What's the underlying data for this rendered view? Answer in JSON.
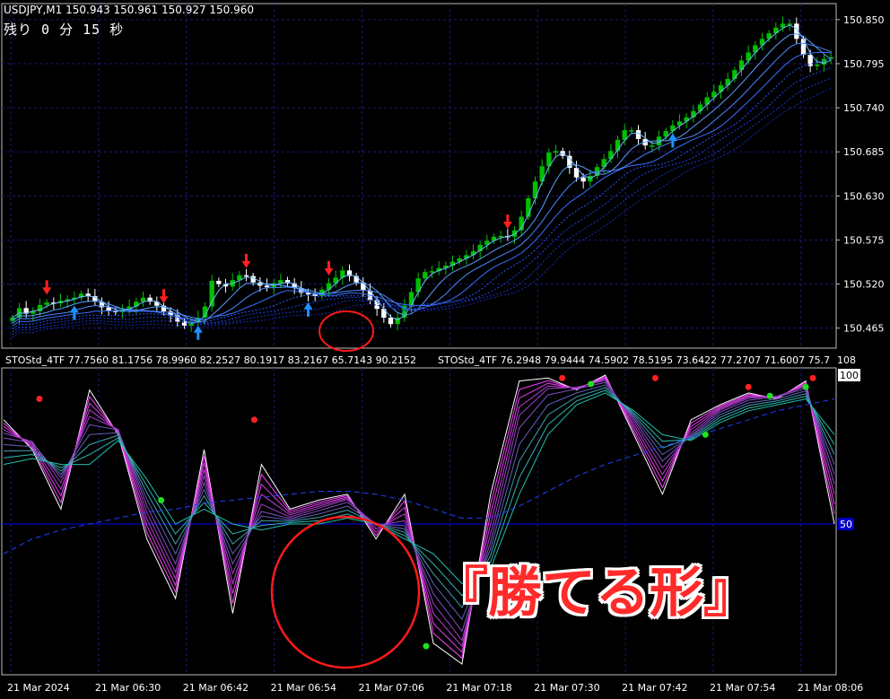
{
  "header": {
    "symbol_line": "USDJPY,M1  150.943 150.961 150.927 150.960",
    "timer": "残り 0 分 15 秒"
  },
  "indicator": {
    "label_1": "STOStd_4TF 77.7560 81.1756 78.9960 82.2527 80.1917 83.2167 65.7143 90.2152",
    "label_2": "STOStd_4TF 76.2948 79.9444 74.5902 78.5195 73.6422 77.2707 71.6007 75.7",
    "right_label": "108"
  },
  "annotation": {
    "text": "『勝てる形』"
  },
  "colors": {
    "background": "#000000",
    "grid": "#1a1a7a",
    "bull_candle": "#00c000",
    "bear_candle": "#ffffff",
    "arrow_up": "#1e90ff",
    "arrow_down": "#ff2020",
    "circle": "#ff1a1a",
    "level_line": "#0000ff"
  },
  "chart_data": [
    {
      "type": "candlestick",
      "title": "USDJPY,M1",
      "y_ticks": [
        "150.850",
        "150.795",
        "150.740",
        "150.685",
        "150.630",
        "150.575",
        "150.520",
        "150.465"
      ],
      "ylim": [
        150.44,
        150.87
      ],
      "x_ticks": [
        "21 Mar 2024",
        "21 Mar 06:30",
        "21 Mar 06:42",
        "21 Mar 06:54",
        "21 Mar 07:06",
        "21 Mar 07:18",
        "21 Mar 07:30",
        "21 Mar 07:42",
        "21 Mar 07:54",
        "21 Mar 08:06"
      ],
      "close": [
        150.478,
        150.49,
        150.483,
        150.486,
        150.494,
        150.497,
        150.496,
        150.499,
        150.501,
        150.503,
        150.508,
        150.505,
        150.498,
        150.491,
        150.487,
        150.485,
        150.488,
        150.492,
        150.498,
        150.503,
        150.498,
        150.493,
        150.486,
        150.481,
        150.473,
        150.468,
        150.472,
        150.478,
        150.492,
        150.524,
        150.52,
        150.517,
        150.525,
        150.531,
        150.53,
        150.522,
        150.518,
        150.516,
        150.521,
        150.525,
        150.521,
        150.515,
        150.509,
        150.507,
        150.505,
        150.513,
        150.521,
        150.528,
        150.537,
        150.53,
        150.522,
        150.512,
        150.5,
        150.489,
        150.478,
        150.47,
        150.478,
        150.493,
        150.51,
        150.527,
        150.535,
        150.536,
        150.54,
        150.543,
        150.548,
        150.552,
        150.556,
        150.561,
        150.569,
        150.574,
        150.579,
        150.58,
        150.579,
        150.587,
        150.604,
        150.627,
        150.648,
        150.667,
        150.684,
        150.686,
        150.68,
        150.665,
        150.653,
        150.648,
        150.655,
        150.666,
        150.676,
        150.686,
        150.7,
        150.712,
        150.712,
        150.701,
        150.693,
        150.693,
        150.704,
        150.711,
        150.718,
        150.723,
        150.728,
        150.736,
        150.744,
        150.753,
        150.76,
        150.768,
        150.776,
        150.787,
        150.799,
        150.809,
        150.818,
        150.826,
        150.833,
        150.84,
        150.845,
        150.845,
        150.826,
        150.806,
        150.792,
        150.794,
        150.801,
        150.803
      ],
      "signals": [
        {
          "type": "sell",
          "index": 5
        },
        {
          "type": "sell",
          "index": 22
        },
        {
          "type": "sell",
          "index": 34
        },
        {
          "type": "sell",
          "index": 46
        },
        {
          "type": "sell",
          "index": 72
        },
        {
          "type": "buy",
          "index": 9
        },
        {
          "type": "buy",
          "index": 27
        },
        {
          "type": "buy",
          "index": 43
        },
        {
          "type": "buy",
          "index": 96
        }
      ]
    },
    {
      "type": "line",
      "title": "STOStd_4TF",
      "y_ticks": [
        "100",
        "50"
      ],
      "ylim": [
        0,
        100
      ],
      "level": 50,
      "x": [
        0,
        4,
        8,
        12,
        16,
        20,
        24,
        28,
        32,
        36,
        40,
        44,
        48,
        52,
        56,
        60,
        64,
        68,
        72,
        76,
        80,
        84,
        88,
        92,
        96,
        100,
        104,
        108,
        112,
        116
      ],
      "series": [
        {
          "values": [
            85,
            75,
            55,
            95,
            80,
            45,
            25,
            75,
            20,
            70,
            55,
            58,
            60,
            45,
            60,
            10,
            3,
            60,
            98,
            99,
            95,
            100,
            80,
            60,
            85,
            90,
            94,
            92,
            98,
            50
          ]
        },
        {
          "values": [
            80,
            78,
            65,
            85,
            82,
            55,
            35,
            65,
            35,
            55,
            52,
            55,
            58,
            50,
            50,
            25,
            12,
            45,
            85,
            95,
            96,
            98,
            85,
            70,
            80,
            88,
            92,
            93,
            96,
            65
          ]
        },
        {
          "values": [
            70,
            72,
            70,
            70,
            78,
            65,
            50,
            55,
            50,
            48,
            50,
            50,
            52,
            50,
            45,
            40,
            30,
            35,
            60,
            80,
            90,
            94,
            88,
            80,
            78,
            84,
            88,
            90,
            92,
            80
          ]
        },
        {
          "values": [
            40,
            45,
            48,
            50,
            52,
            54,
            55,
            57,
            58,
            59,
            60,
            61,
            61,
            60,
            58,
            55,
            52,
            52,
            56,
            61,
            66,
            70,
            73,
            76,
            79,
            82,
            85,
            88,
            90,
            92
          ]
        }
      ],
      "markers": [
        {
          "color": "red",
          "x": 5,
          "y": 92
        },
        {
          "color": "red",
          "x": 35,
          "y": 85
        },
        {
          "color": "green",
          "x": 22,
          "y": 58
        },
        {
          "color": "green",
          "x": 59,
          "y": 9
        },
        {
          "color": "red",
          "x": 78,
          "y": 99
        },
        {
          "color": "red",
          "x": 91,
          "y": 99
        },
        {
          "color": "green",
          "x": 82,
          "y": 97
        },
        {
          "color": "green",
          "x": 98,
          "y": 80
        },
        {
          "color": "red",
          "x": 104,
          "y": 96
        },
        {
          "color": "green",
          "x": 107,
          "y": 93
        },
        {
          "color": "green",
          "x": 112,
          "y": 96
        },
        {
          "color": "red",
          "x": 113,
          "y": 99
        }
      ]
    }
  ]
}
